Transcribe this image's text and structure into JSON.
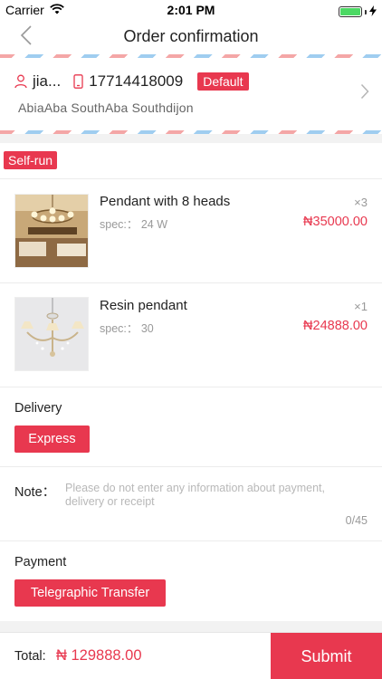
{
  "status_bar": {
    "carrier": "Carrier",
    "time": "2:01 PM"
  },
  "nav": {
    "title": "Order confirmation",
    "back_icon": "chevron-left-icon"
  },
  "address": {
    "name": "jia...",
    "phone": "17714418009",
    "default_label": "Default",
    "detail": "AbiaAba SouthAba Southdijon"
  },
  "store": {
    "badge": "Self-run"
  },
  "products": [
    {
      "name": "Pendant with 8 heads",
      "spec": "spec:： 24 W",
      "quantity": "×3",
      "price": "₦35000.00"
    },
    {
      "name": "Resin pendant",
      "spec": "spec:： 30",
      "quantity": "×1",
      "price": "₦24888.00"
    }
  ],
  "delivery": {
    "label": "Delivery",
    "option": "Express"
  },
  "note": {
    "label": "Note：",
    "placeholder": "Please do not enter any information about payment, delivery or receipt",
    "value": "",
    "count": "0/45"
  },
  "payment": {
    "label": "Payment",
    "option": "Telegraphic Transfer"
  },
  "footer": {
    "total_label": "Total:",
    "total_value": "₦ 129888.00",
    "submit_label": "Submit"
  },
  "colors": {
    "accent": "#e8384f",
    "battery": "#4cd964",
    "stripe_red": "#f4a6a6",
    "stripe_blue": "#9fcdf0"
  }
}
